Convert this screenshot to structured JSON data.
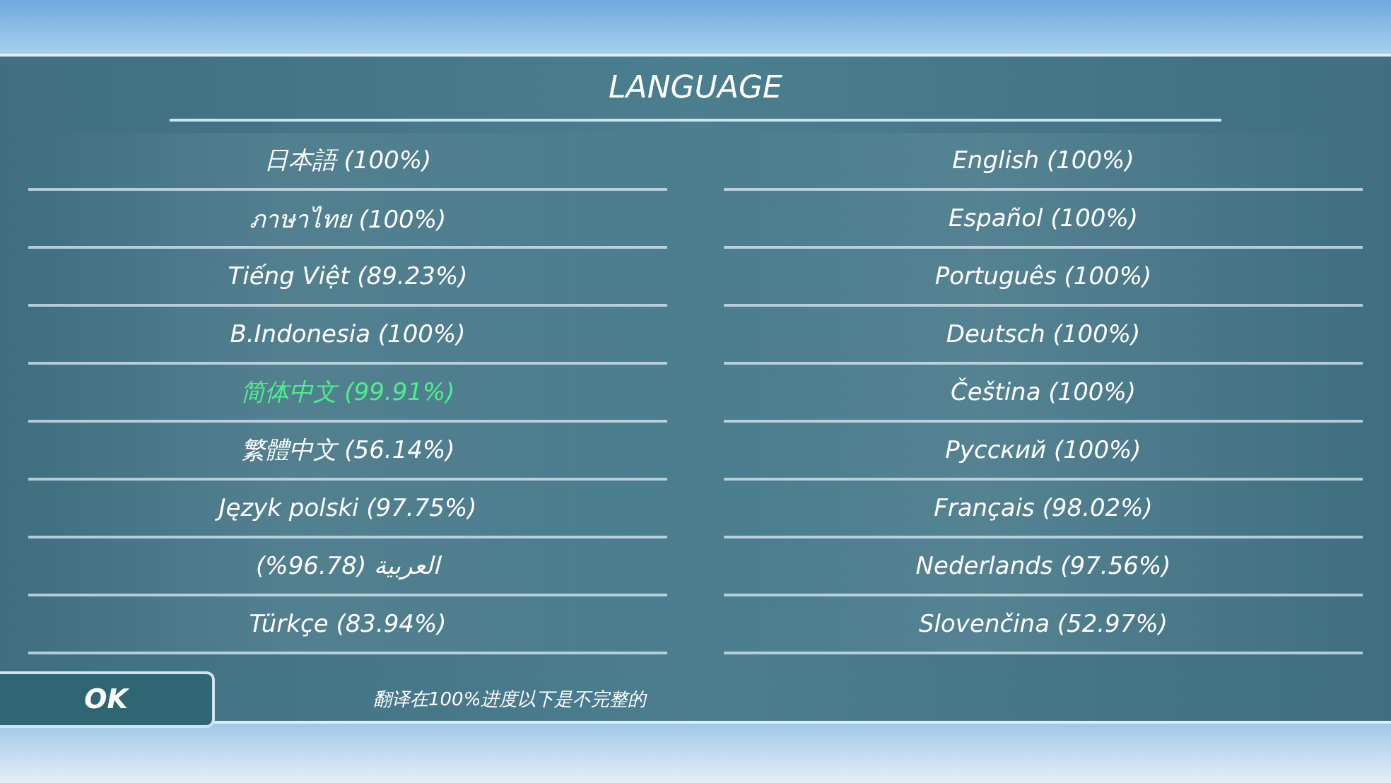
{
  "title": "LANGUAGE",
  "languages": [
    {
      "label": "日本語 (100%)",
      "selected": false
    },
    {
      "label": "English (100%)",
      "selected": false
    },
    {
      "label": "ภาษาไทย (100%)",
      "selected": false
    },
    {
      "label": "Español (100%)",
      "selected": false
    },
    {
      "label": "Tiếng Việt (89.23%)",
      "selected": false
    },
    {
      "label": "Português (100%)",
      "selected": false
    },
    {
      "label": "B.Indonesia (100%)",
      "selected": false
    },
    {
      "label": "Deutsch (100%)",
      "selected": false
    },
    {
      "label": "简体中文 (99.91%)",
      "selected": true
    },
    {
      "label": "Čeština (100%)",
      "selected": false
    },
    {
      "label": "繁體中文 (56.14%)",
      "selected": false
    },
    {
      "label": "Русский (100%)",
      "selected": false
    },
    {
      "label": "Język polski (97.75%)",
      "selected": false
    },
    {
      "label": "Français (98.02%)",
      "selected": false
    },
    {
      "label": "العربية (96.78%)",
      "selected": false
    },
    {
      "label": "Nederlands (97.56%)",
      "selected": false
    },
    {
      "label": "Türkçe (83.94%)",
      "selected": false
    },
    {
      "label": "Slovenčina (52.97%)",
      "selected": false
    }
  ],
  "ok_button": "OK",
  "note": "翻译在100%进度以下是不完整的"
}
